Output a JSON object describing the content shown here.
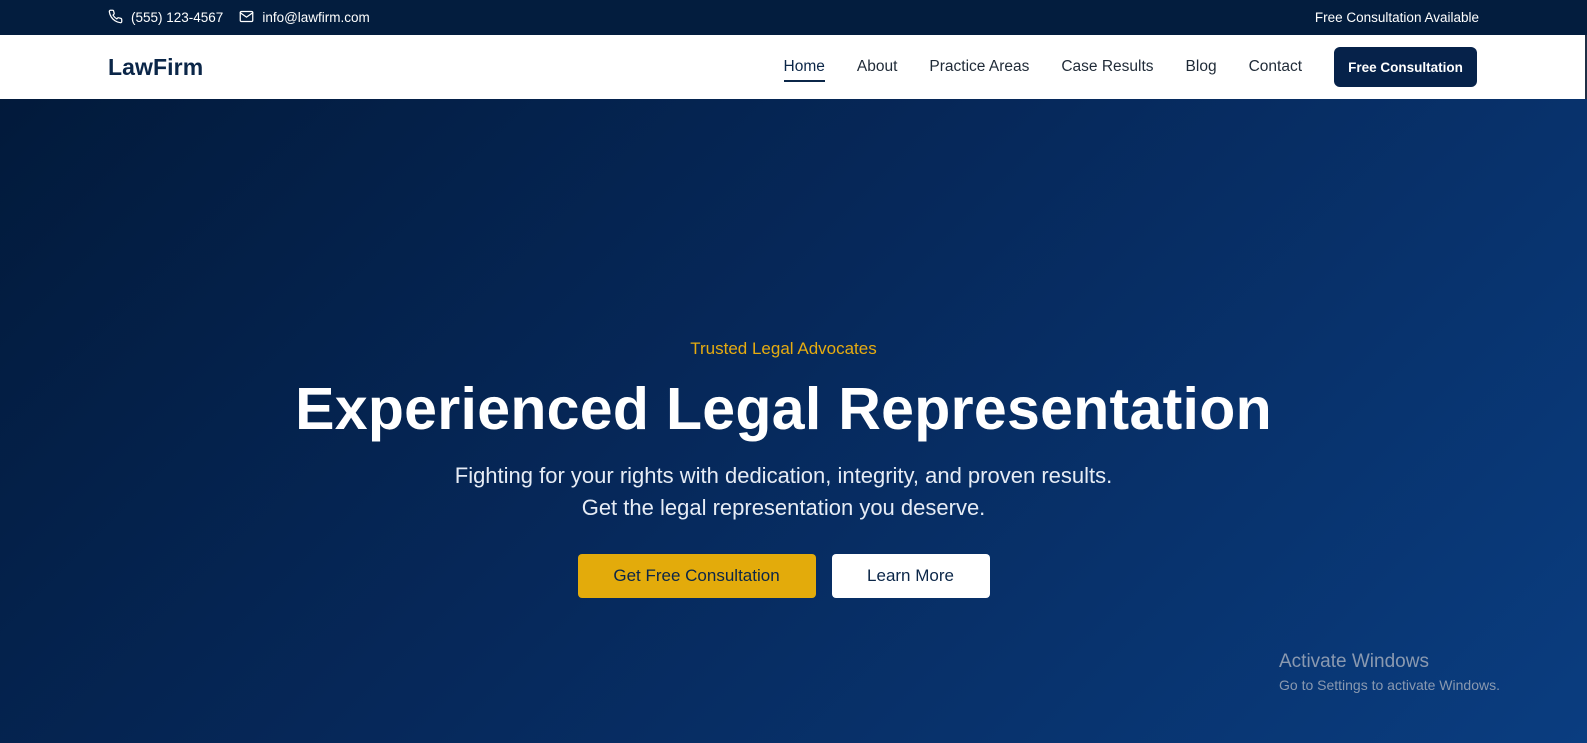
{
  "topbar": {
    "phone": "(555) 123-4567",
    "email": "info@lawfirm.com",
    "right_text": "Free Consultation Available",
    "phone_icon": "phone-icon",
    "email_icon": "mail-icon"
  },
  "header": {
    "logo": "LawFirm",
    "nav": [
      {
        "label": "Home",
        "active": true
      },
      {
        "label": "About",
        "active": false
      },
      {
        "label": "Practice Areas",
        "active": false
      },
      {
        "label": "Case Results",
        "active": false
      },
      {
        "label": "Blog",
        "active": false
      },
      {
        "label": "Contact",
        "active": false
      }
    ],
    "cta_label": "Free Consultation"
  },
  "hero": {
    "eyebrow": "Trusted Legal Advocates",
    "title": "Experienced Legal Representation",
    "subtitle_line1": "Fighting for your rights with dedication, integrity, and proven results.",
    "subtitle_line2": "Get the legal representation you deserve.",
    "primary_button": "Get Free Consultation",
    "secondary_button": "Learn More"
  },
  "watermark": {
    "title": "Activate Windows",
    "subtitle": "Go to Settings to activate Windows."
  },
  "colors": {
    "navy": "#0b2648",
    "topbar": "#031d3e",
    "gold": "#e3ab0b",
    "white": "#ffffff"
  }
}
